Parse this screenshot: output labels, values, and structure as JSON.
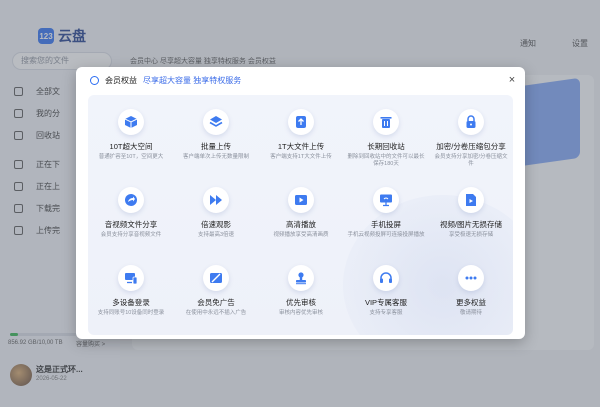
{
  "app": {
    "logo_text": "云盘",
    "logo_badge": "123",
    "search_placeholder": "搜索您的文件",
    "nav": [
      "全部文",
      "我的分",
      "回收站",
      "正在下",
      "正在上",
      "下载完",
      "上传完"
    ],
    "storage_text": "856.92 GB/10,00 TB",
    "expand_label": "容量购买 >",
    "user_name": "这是正式环...",
    "user_date": "2026-05-22",
    "notify_label": "通知",
    "settings_label": "设置",
    "tabs_text": "会员中心   尽享超大容量 独享特权服务            会员权益"
  },
  "modal": {
    "title": "会员权益",
    "subtitle": "尽享超大容量 独享特权服务",
    "close_symbol": "×"
  },
  "features": [
    {
      "title": "10T超大空间",
      "desc": "普通扩容至10T，空间更大",
      "icon": "cube-icon"
    },
    {
      "title": "批量上传",
      "desc": "客户端单次上传无数量限制",
      "icon": "layers-icon"
    },
    {
      "title": "1T大文件上传",
      "desc": "客户端支持1T大文件上传",
      "icon": "upload-icon"
    },
    {
      "title": "长期回收站",
      "desc": "删除到回收站中的文件可以最长保存180天",
      "icon": "trash-icon"
    },
    {
      "title": "加密/分卷压缩包分享",
      "desc": "会员支持分享加密/分卷压缩文件",
      "icon": "lock-icon"
    },
    {
      "title": "音视频文件分享",
      "desc": "会员支持分享音视频文件",
      "icon": "share-icon"
    },
    {
      "title": "倍速观影",
      "desc": "支持最高3倍速",
      "icon": "fast-forward-icon"
    },
    {
      "title": "高清播放",
      "desc": "视频播放享受高清画质",
      "icon": "video-icon"
    },
    {
      "title": "手机投屏",
      "desc": "手机云视频投屏可连接投屏播放",
      "icon": "cast-icon"
    },
    {
      "title": "视频/图片无损存储",
      "desc": "享受极速无损存储",
      "icon": "media-file-icon"
    },
    {
      "title": "多设备登录",
      "desc": "支持同账号10设备同时登录",
      "icon": "devices-icon"
    },
    {
      "title": "会员免广告",
      "desc": "在使用中永远不插入广告",
      "icon": "no-ads-icon"
    },
    {
      "title": "优先审核",
      "desc": "审核内容优先审核",
      "icon": "stamp-icon"
    },
    {
      "title": "VIP专属客服",
      "desc": "支持专享客服",
      "icon": "headset-icon"
    },
    {
      "title": "更多权益",
      "desc": "敬请期待",
      "icon": "more-icon"
    }
  ],
  "colors": {
    "accent": "#2b6df2",
    "icon_blue": "#3e7bf0",
    "panel": "#eef1f9"
  }
}
